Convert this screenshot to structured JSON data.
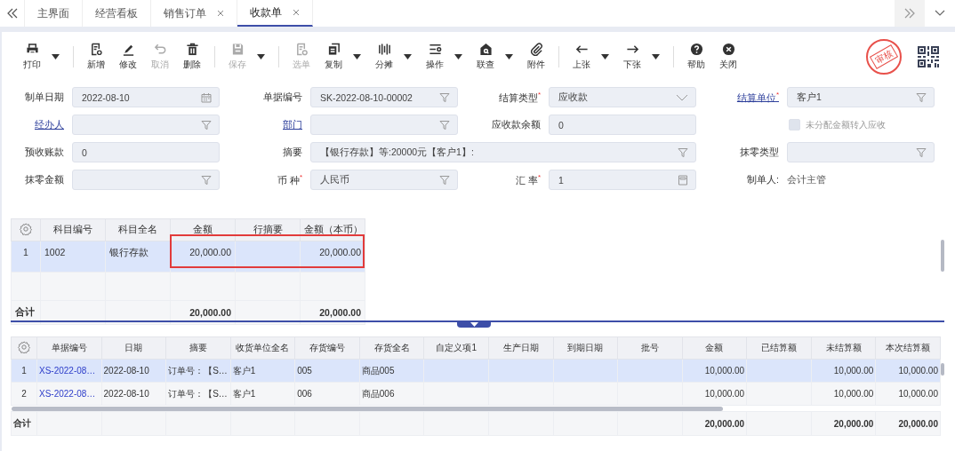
{
  "tabs": [
    {
      "label": "主界面",
      "closable": false,
      "selected": false
    },
    {
      "label": "经营看板",
      "closable": false,
      "selected": false
    },
    {
      "label": "销售订单",
      "closable": true,
      "selected": false
    },
    {
      "label": "收款单",
      "closable": true,
      "selected": true
    }
  ],
  "toolbar": [
    [
      {
        "label": "打印",
        "dropdown": true,
        "disabled": false
      }
    ],
    [
      {
        "label": "新增",
        "dropdown": false,
        "disabled": false
      },
      {
        "label": "修改",
        "dropdown": false,
        "disabled": false
      },
      {
        "label": "取消",
        "dropdown": false,
        "disabled": true
      },
      {
        "label": "删除",
        "dropdown": false,
        "disabled": false
      }
    ],
    [
      {
        "label": "保存",
        "dropdown": true,
        "disabled": true
      }
    ],
    [
      {
        "label": "选单",
        "dropdown": false,
        "disabled": true
      },
      {
        "label": "复制",
        "dropdown": true,
        "disabled": false
      },
      {
        "label": "分摊",
        "dropdown": true,
        "disabled": false
      },
      {
        "label": "操作",
        "dropdown": true,
        "disabled": false
      },
      {
        "label": "联查",
        "dropdown": true,
        "disabled": false
      },
      {
        "label": "附件",
        "dropdown": false,
        "disabled": false
      }
    ],
    [
      {
        "label": "上张",
        "dropdown": true,
        "disabled": false
      },
      {
        "label": "下张",
        "dropdown": true,
        "disabled": false
      }
    ],
    [
      {
        "label": "帮助",
        "dropdown": false,
        "disabled": false
      },
      {
        "label": "关闭",
        "dropdown": false,
        "disabled": false
      }
    ]
  ],
  "stamp": "审核",
  "form": [
    [
      {
        "kind": "date",
        "label": "制单日期",
        "link": false,
        "value": "2022-08-10",
        "wide": false
      },
      {
        "kind": "filter",
        "label": "单据编号",
        "link": false,
        "value": "SK-2022-08-10-00002",
        "wide": false
      },
      {
        "kind": "select",
        "label": "结算类型$^{*}$",
        "link": false,
        "value": "应收款",
        "wide": false
      },
      {
        "kind": "filter",
        "label": "结算单位$^{*}$",
        "link": true,
        "value": "客户1",
        "wide": false
      }
    ],
    [
      {
        "kind": "filter",
        "label": "经办人",
        "link": true,
        "wide": false
      },
      {
        "kind": "filter",
        "label": "部门",
        "link": true,
        "wide": false
      },
      {
        "kind": "text",
        "label": "应收款余额",
        "link": false,
        "value": "0",
        "wide": false
      },
      {
        "kind": "checkbox",
        "label": "未分配金额转入应收",
        "checked": false,
        "disabled": true
      }
    ],
    [
      {
        "kind": "text",
        "label": "预收账款",
        "link": false,
        "value": "0",
        "wide": false
      },
      {
        "kind": "filter",
        "label": "摘要",
        "link": false,
        "value": "【银行存款】等:20000元【客户1】:",
        "wide": true
      },
      {
        "kind": "filter",
        "label": "抹零类型",
        "link": false,
        "wide": false
      }
    ],
    [
      {
        "kind": "filter",
        "label": "抹零金额",
        "link": false,
        "wide": false
      },
      {
        "kind": "filter",
        "label": "币 种$^{*}$",
        "link": false,
        "value": "人民币",
        "wide": false
      },
      {
        "kind": "calc",
        "label": "汇 率$^{*}$",
        "link": false,
        "value": "1",
        "wide": false
      },
      {
        "kind": "plain",
        "label": "制单人:",
        "value": "会计主管"
      }
    ]
  ],
  "account_table": {
    "columns": [
      {
        "title": "科目编号",
        "kind": "text"
      },
      {
        "title": "科目全名",
        "kind": "text"
      },
      {
        "title": "金额",
        "kind": "amount",
        "total": "20,000.00"
      },
      {
        "title": "行摘要",
        "kind": "text"
      },
      {
        "title": "金额（本币）",
        "kind": "amount",
        "total": "20,000.00"
      }
    ],
    "rows": [
      {
        "no": "1",
        "selected": true,
        "cells": [
          "1002",
          "银行存款",
          "20,000.00",
          null,
          "20,000.00"
        ]
      }
    ],
    "total_label": "合计"
  },
  "order_table": {
    "columns": [
      {
        "title": "单据编号",
        "kind": "link"
      },
      {
        "title": "日期",
        "kind": "text"
      },
      {
        "title": "摘要",
        "kind": "text"
      },
      {
        "title": "收货单位全名",
        "kind": "text"
      },
      {
        "title": "存货编号",
        "kind": "text"
      },
      {
        "title": "存货全名",
        "kind": "text"
      },
      {
        "title": "自定义项1",
        "kind": "text"
      },
      {
        "title": "生产日期",
        "kind": "text"
      },
      {
        "title": "到期日期",
        "kind": "text"
      },
      {
        "title": "批号",
        "kind": "text"
      },
      {
        "title": "金额",
        "kind": "amount",
        "total": "20,000.00"
      },
      {
        "title": "已结算额",
        "kind": "amount"
      },
      {
        "title": "未结算额",
        "kind": "amount",
        "total": "20,000.00"
      },
      {
        "title": "本次结算额",
        "kind": "amount",
        "total": "20,000.00"
      }
    ],
    "rows": [
      {
        "no": "1",
        "selected": true,
        "cells": [
          "XS-2022-08…",
          "2022-08-10",
          "订单号：【S…",
          "客户1",
          "005",
          "商品005",
          null,
          null,
          null,
          null,
          "10,000.00",
          null,
          "10,000.00",
          "10,000.00"
        ]
      },
      {
        "no": "2",
        "selected": false,
        "cells": [
          "XS-2022-08…",
          "2022-08-10",
          "订单号：【S…",
          "客户1",
          "006",
          "商品006",
          null,
          null,
          null,
          null,
          "10,000.00",
          null,
          "10,000.00",
          "10,000.00"
        ]
      }
    ],
    "total_label": "合计"
  }
}
